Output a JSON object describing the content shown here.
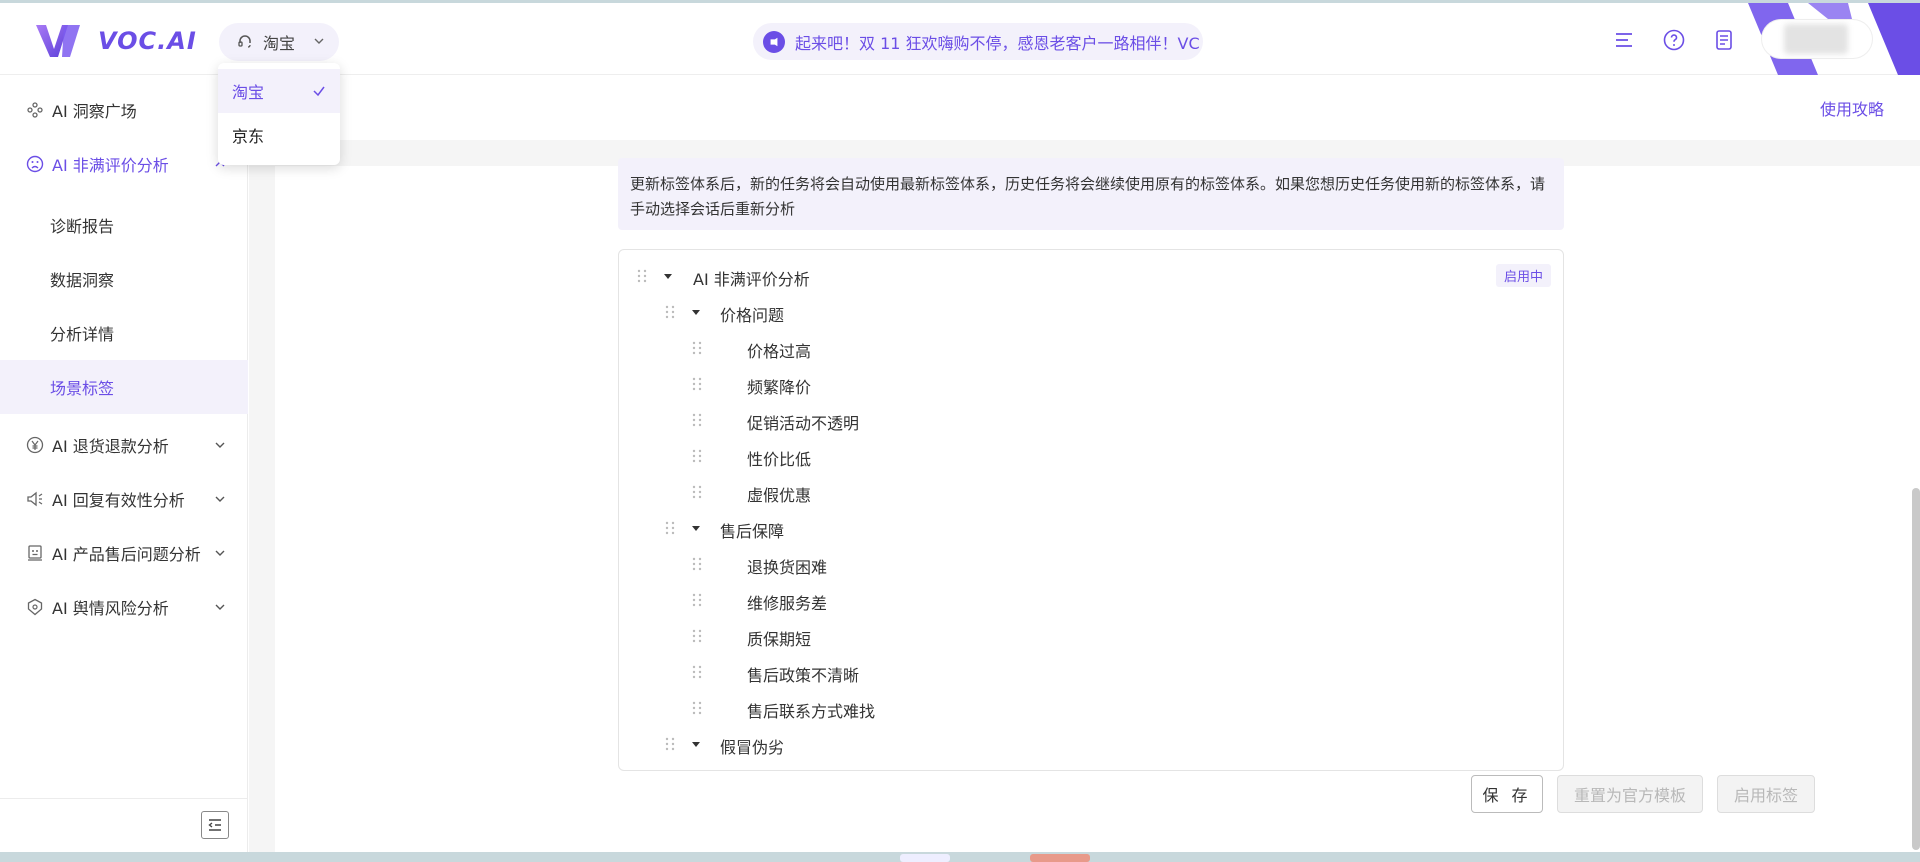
{
  "brand": {
    "name": "VOC.AI",
    "accent": "#6b4ee6"
  },
  "header": {
    "platform_selected": "淘宝",
    "banner_text": "起来吧！双 11 狂欢嗨购不停，感恩老客户一路相伴！VC",
    "icons": [
      "menu-icon",
      "help-icon",
      "document-icon"
    ]
  },
  "platform_dropdown": {
    "options": [
      {
        "label": "淘宝",
        "selected": true
      },
      {
        "label": "京东",
        "selected": false
      }
    ]
  },
  "sidebar": {
    "items": [
      {
        "label": "AI 洞察广场",
        "icon": "insight-icon"
      },
      {
        "label": "AI 非满评价分析",
        "icon": "sad-face-icon",
        "expanded": true,
        "children": [
          "诊断报告",
          "数据洞察",
          "分析详情",
          "场景标签"
        ],
        "active_child": "场景标签"
      },
      {
        "label": "AI 退货退款分析",
        "icon": "yen-icon"
      },
      {
        "label": "AI 回复有效性分析",
        "icon": "speaker-icon"
      },
      {
        "label": "AI 产品售后问题分析",
        "icon": "robot-icon"
      },
      {
        "label": "AI 舆情风险分析",
        "icon": "shield-icon"
      }
    ]
  },
  "main": {
    "guide_link": "使用攻略",
    "notice": "更新标签体系后，新的任务将会自动使用最新标签体系，历史任务将会继续使用原有的标签体系。如果您想历史任务使用新的标签体系，请手动选择会话后重新分析",
    "tree": {
      "root": "AI 非满评价分析",
      "status": "启用中",
      "groups": [
        {
          "label": "价格问题",
          "children": [
            "价格过高",
            "频繁降价",
            "促销活动不透明",
            "性价比低",
            "虚假优惠"
          ]
        },
        {
          "label": "售后保障",
          "children": [
            "退换货困难",
            "维修服务差",
            "质保期短",
            "售后政策不清晰",
            "售后联系方式难找"
          ]
        },
        {
          "label": "假冒伪劣",
          "children": []
        }
      ]
    },
    "buttons": {
      "save": "保 存",
      "reset": "重置为官方模板",
      "enable": "启用标签"
    }
  }
}
